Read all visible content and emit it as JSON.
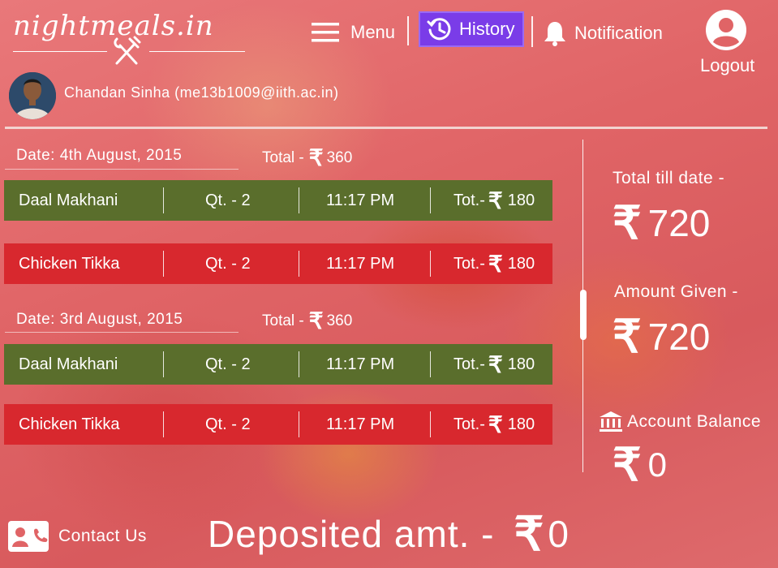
{
  "brand": {
    "logo_text": "nightmeals.in"
  },
  "nav": {
    "menu_label": "Menu",
    "history_label": "History",
    "notification_label": "Notification",
    "logout_label": "Logout"
  },
  "user": {
    "name_email": "Chandan Sinha (me13b1009@iith.ac.in)"
  },
  "currency_symbol": "₹",
  "orders": [
    {
      "date_label": "Date: 4th August, 2015",
      "total_prefix": "Total -",
      "total_value": "360",
      "items": [
        {
          "name": "Daal Makhani",
          "qty": "Qt. - 2",
          "time": "11:17 PM",
          "tot_prefix": "Tot.-",
          "tot_value": "180",
          "color": "#5a6e2c"
        },
        {
          "name": "Chicken Tikka",
          "qty": "Qt. - 2",
          "time": "11:17 PM",
          "tot_prefix": "Tot.-",
          "tot_value": "180",
          "color": "#d8282e"
        }
      ]
    },
    {
      "date_label": "Date: 3rd August, 2015",
      "total_prefix": "Total -",
      "total_value": "360",
      "items": [
        {
          "name": "Daal Makhani",
          "qty": "Qt. - 2",
          "time": "11:17 PM",
          "tot_prefix": "Tot.-",
          "tot_value": "180",
          "color": "#5a6e2c"
        },
        {
          "name": "Chicken Tikka",
          "qty": "Qt. - 2",
          "time": "11:17 PM",
          "tot_prefix": "Tot.-",
          "tot_value": "180",
          "color": "#d8282e"
        }
      ]
    }
  ],
  "summary": {
    "total_label": "Total till date -",
    "total_value": "720",
    "given_label": "Amount Given -",
    "given_value": "720",
    "balance_label": "Account Balance",
    "balance_value": "0"
  },
  "footer": {
    "contact_label": "Contact Us",
    "deposited_label": "Deposited amt. -",
    "deposited_value": "0"
  },
  "colors": {
    "history_bg": "#7a3ce8",
    "veg_row": "#5a6e2c",
    "nonveg_row": "#d8282e"
  }
}
